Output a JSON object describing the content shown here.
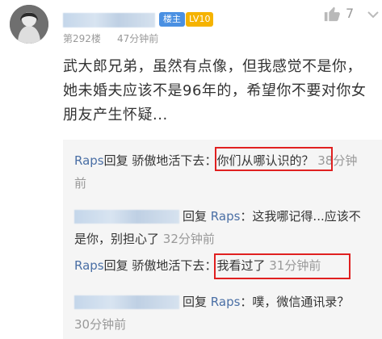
{
  "post": {
    "role_badge": "楼主",
    "level_badge": "LV10",
    "likes": "7",
    "floor": "第292楼",
    "time": "47分钟前",
    "content": "武大郎兄弟，虽然有点像，但我感觉不是你，她未婚夫应该不是96年的，希望你不要对你女朋友产生怀疑..."
  },
  "replies": [
    {
      "name": "Raps",
      "verb": "回复",
      "target": "骄傲地活下去",
      "text": "：你们从哪认识的？",
      "time": "38分钟前"
    },
    {
      "name": "",
      "verb": "回复",
      "target": "Raps",
      "text": "：这我哪记得...应该不是你，别担心了",
      "time": "32分钟前"
    },
    {
      "name": "Raps",
      "verb": "回复",
      "target": "骄傲地活下去",
      "text": "：我看过了",
      "time": "31分钟前"
    },
    {
      "name": "",
      "verb": "回复",
      "target": "Raps",
      "text": "：噗，微信通讯录？",
      "time": "30分钟前"
    }
  ],
  "icons": {
    "like": "thumb-up-icon",
    "more": "chevron-down-icon"
  },
  "colors": {
    "username_link": "#4a6fa5",
    "highlight": "#e02020",
    "level_badge": "#f5b300",
    "role_badge": "#4a90e2"
  }
}
